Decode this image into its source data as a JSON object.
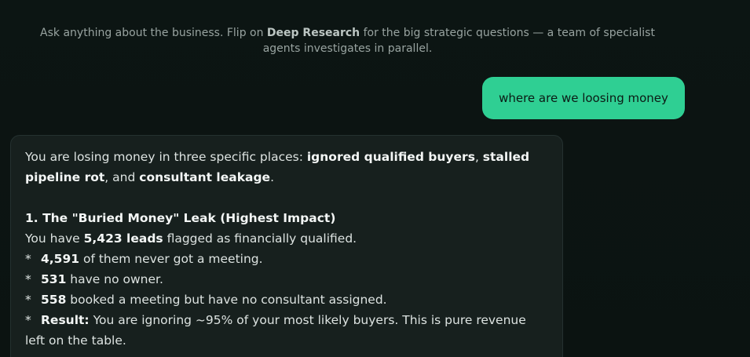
{
  "intro": {
    "before": "Ask anything about the business. Flip on ",
    "highlight": "Deep Research",
    "after": " for the big strategic questions — a team of specialist agents investigates in parallel."
  },
  "user_message": "where are we loosing money",
  "assistant": {
    "summary_start": "You are losing money in three specific places: ",
    "place1": "ignored qualified buyers",
    "sep1": ", ",
    "place2": "stalled pipeline rot",
    "sep2": ", and ",
    "place3": "consultant leakage",
    "summary_end": ".",
    "section1_heading": "1. The \"Buried Money\" Leak (Highest Impact)",
    "section1_intro_before": "You have ",
    "section1_intro_value": "5,423 leads",
    "section1_intro_after": " flagged as financially qualified.",
    "bullets": [
      {
        "star": "*",
        "bold": "4,591",
        "text": " of them never got a meeting."
      },
      {
        "star": "*",
        "bold": "531",
        "text": " have no owner."
      },
      {
        "star": "*",
        "bold": "558",
        "text": " booked a meeting but have no consultant assigned."
      },
      {
        "star": "*",
        "bold": "Result:",
        "text": " You are ignoring ~95% of your most likely buyers. This is pure revenue left on the table."
      }
    ]
  }
}
